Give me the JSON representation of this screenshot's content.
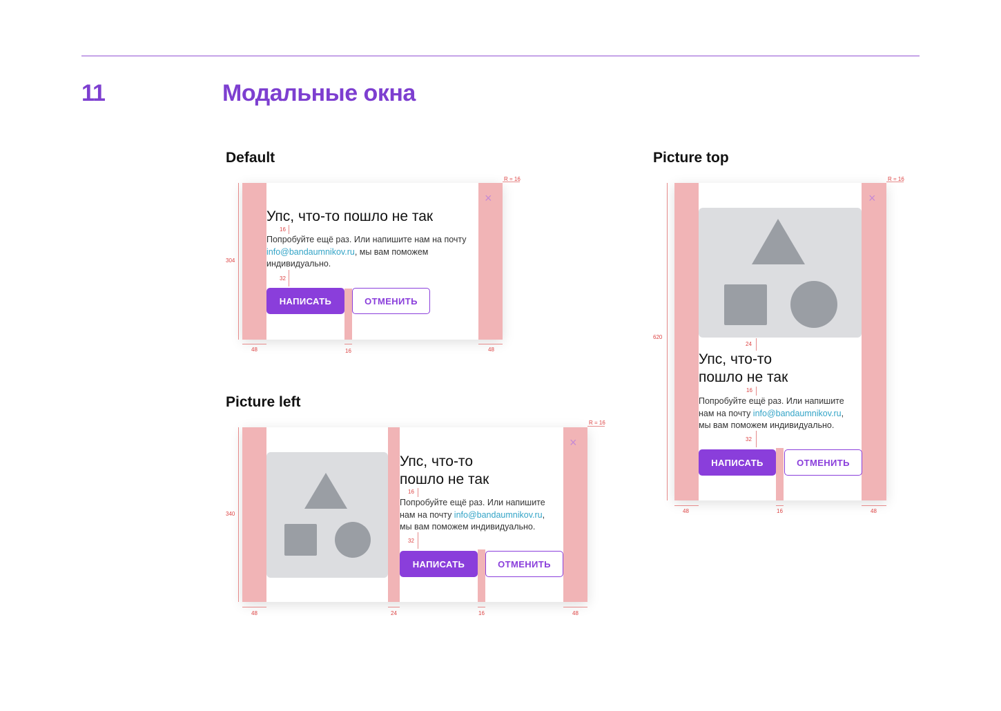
{
  "section": {
    "number": "11",
    "title": "Модальные окна"
  },
  "variants": {
    "default": "Default",
    "picture_left": "Picture left",
    "picture_top": "Picture top"
  },
  "modal": {
    "title": "Упс, что-то пошло не так",
    "title_line1": "Упс, что-то",
    "title_line2": "пошло не так",
    "text_default_1": "Попробуйте ещё раз. Или напишите нам на почту",
    "text_default_3": ", мы вам поможем",
    "text_default_4": "индивидуально.",
    "text_narrow_1": "Попробуйте ещё раз. Или напишите",
    "text_narrow_2": "нам на почту ",
    "text_narrow_3": ",",
    "text_left_4": "мы вам поможем индивидуально.",
    "text_top_4": "мы вам поможем индивидуально.",
    "email": "info@bandaumnikov.ru",
    "primary_button": "НАПИСАТЬ",
    "secondary_button": "ОТМЕНИТЬ",
    "close_icon": "×"
  },
  "dimensions": {
    "radius": "R = 16",
    "d48": "48",
    "d16": "16",
    "d24": "24",
    "d32": "32",
    "h304": "304",
    "h340": "340",
    "h620": "620"
  },
  "colors": {
    "accent": "#8a3edb",
    "heading": "#7d3fd0",
    "padding_overlay": "#f1b4b6",
    "link": "#33a4c7",
    "picture_bg": "#dcdde0",
    "shape": "#9a9ea4"
  },
  "icons": {
    "close": "close-icon",
    "triangle": "triangle-shape",
    "square": "square-shape",
    "circle": "circle-shape"
  }
}
